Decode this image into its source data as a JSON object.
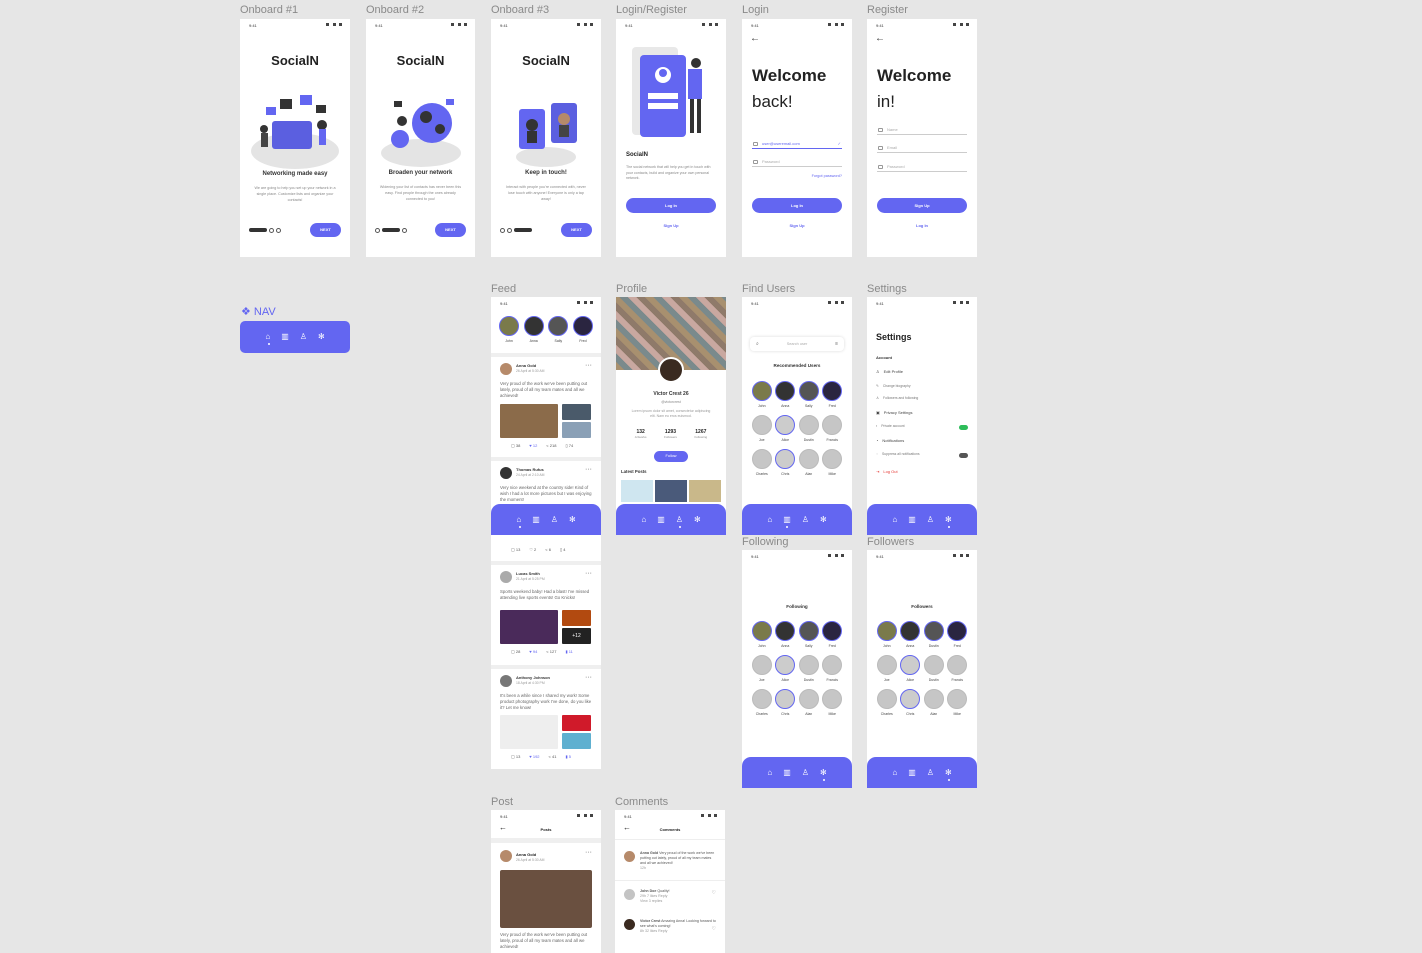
{
  "labels": {
    "onboard1": "Onboard #1",
    "onboard2": "Onboard #2",
    "onboard3": "Onboard #3",
    "login_register": "Login/Register",
    "login": "Login",
    "register": "Register",
    "nav": "NAV",
    "feed": "Feed",
    "profile": "Profile",
    "find_users": "Find Users",
    "settings": "Settings",
    "following": "Following",
    "followers": "Followers",
    "post": "Post",
    "comments": "Comments"
  },
  "time": "9:41",
  "brand": "SocialN",
  "onboard": [
    {
      "title": "Networking made easy",
      "desc": "We are going to help you set up your network in a single place. Customize lists and organize your contacts!",
      "button": "NEXT"
    },
    {
      "title": "Broaden your network",
      "desc": "Widening your list of contacts has never been this easy. Find people through the ones already connected to you!",
      "button": "NEXT"
    },
    {
      "title": "Keep in touch!",
      "desc": "Interact with people you're connected with, never lose touch with anyone! Everyone is only a tap away!",
      "button": "NEXT"
    }
  ],
  "login_register": {
    "name": "SocialN",
    "desc": "The social network that will help you get in touch with your contacts, build and organize your own personal network.",
    "login_button": "Log In",
    "signup_link": "Sign Up"
  },
  "login": {
    "line1": "Welcome",
    "line2": "back!",
    "email_value": "user@useremail.com",
    "password_placeholder": "Password",
    "forgot": "Forgot password?",
    "button": "Log In",
    "link": "Sign Up"
  },
  "register": {
    "line1": "Welcome",
    "line2": "in!",
    "name_placeholder": "Name",
    "email_placeholder": "Email",
    "password_placeholder": "Password",
    "button": "Sign Up",
    "link": "Log In"
  },
  "nav_icons": [
    "home-icon",
    "map-icon",
    "user-icon",
    "settings-icon"
  ],
  "nav_glyphs": [
    "⌂",
    "▥",
    "♙",
    "✻"
  ],
  "stories": [
    "John",
    "Anna",
    "Sally",
    "Fred"
  ],
  "feed_posts": [
    {
      "name": "Anna Gold",
      "date": "26 April at 5:30 AM",
      "text": "Very proud of the work we've been putting out lately, proud of all my team mates and all we achieved!",
      "comments": "38",
      "likes": "12",
      "shares": "218",
      "saves": "74"
    },
    {
      "name": "Thomas Rufus",
      "date": "24 April at 2:10 AM",
      "text": "Very nice weekend at the country side! Kind of wish I had a lot more pictures but I was enjoying the moment!",
      "comments": "13",
      "likes": "2",
      "shares": "6",
      "saves": "4"
    },
    {
      "name": "Lucas Smith",
      "date": "21 April at 5:25 PM",
      "text": "Sports weekend baby! Had a blast! I've missed attending live sports events! Go Knicks!",
      "comments": "28",
      "likes": "94",
      "shares": "127",
      "saves": "11",
      "more": "+12"
    },
    {
      "name": "Anthony Johnson",
      "date": "18 April at 4:30 PM",
      "text": "It's been a while since I shared my work! Some product photography work I've done, do you like it? Let me know!",
      "comments": "13",
      "likes": "192",
      "shares": "41",
      "saves": "5"
    }
  ],
  "profile": {
    "name": "Victor Crest 26",
    "handle": "@victorcrest",
    "bio": "Lorem ipsum dolor sit amet, consectetur adipiscing elit. Nam eu eros euismod.",
    "stats": [
      {
        "value": "132",
        "label": "Artworks"
      },
      {
        "value": "1293",
        "label": "Followers"
      },
      {
        "value": "1267",
        "label": "Following"
      }
    ],
    "follow": "Follow",
    "latest": "Latest Posts"
  },
  "find_users": {
    "search_placeholder": "Search user",
    "heading": "Recommended Users",
    "users": [
      "John",
      "Anna",
      "Sally",
      "Fred",
      "Joe",
      "Alice",
      "Dustin",
      "Francis",
      "Charles",
      "Chris",
      "Alan",
      "Mike"
    ]
  },
  "settings": {
    "title": "Settings",
    "account": "Account",
    "edit_profile": "Edit Profile",
    "change_bio": "Change biography",
    "followers_following": "Followers and following",
    "privacy": "Privacy Settings",
    "private_account": "Private account",
    "notifications": "Notifications",
    "suppress": "Suppress all notifications",
    "logout": "Log Out"
  },
  "following": {
    "heading": "Following",
    "users": [
      "John",
      "Anna",
      "Sally",
      "Fred",
      "Joe",
      "Alice",
      "Dustin",
      "Francis",
      "Charles",
      "Chris",
      "Alan",
      "Mike"
    ]
  },
  "followers": {
    "heading": "Followers",
    "users": [
      "John",
      "Anna",
      "Dustin",
      "Fred",
      "Joe",
      "Alice",
      "Dustin",
      "Francis",
      "Charles",
      "Chris",
      "Alan",
      "Mike"
    ]
  },
  "post_screen": {
    "header": "Posts",
    "name": "Anna Gold",
    "date": "26 April at 5:30 AM",
    "text": "Very proud of the work we've been putting out lately, proud of all my team mates and all we achieved!"
  },
  "comments_screen": {
    "header": "Comments",
    "items": [
      {
        "name": "Anna Gold",
        "text": "Very proud of the work we've been putting out lately, proud of all my team mates and all we achieved!",
        "meta": "12h"
      },
      {
        "name": "John Doe",
        "text": "Quality!",
        "meta": "29h   7 likes   Reply",
        "sub": "View 3 replies"
      },
      {
        "name": "Victor Crest",
        "text": "Amazing Anna! Looking forward to see what's coming!",
        "meta": "8h   32 likes   Reply"
      }
    ]
  },
  "colors": {
    "accent": "#6366f1",
    "toggle_on": "#2dbd5a",
    "logout": "#e53935"
  }
}
